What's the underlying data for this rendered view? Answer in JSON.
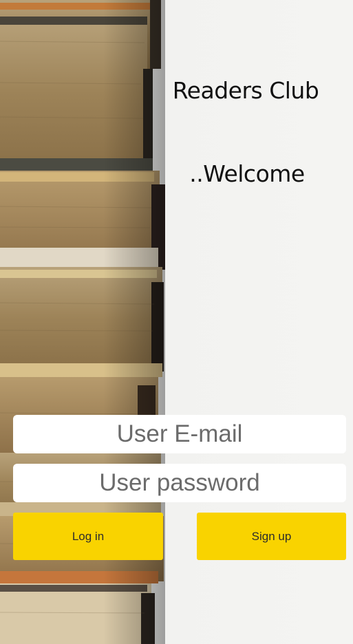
{
  "app": {
    "title": "Readers Club",
    "welcome": "..Welcome"
  },
  "form": {
    "email_placeholder": "User E-mail",
    "email_value": "",
    "password_placeholder": "User password",
    "password_value": "",
    "login_label": "Log in",
    "signup_label": "Sign up"
  },
  "colors": {
    "button_background": "#f9d300",
    "page_background": "#f2f2f0"
  }
}
